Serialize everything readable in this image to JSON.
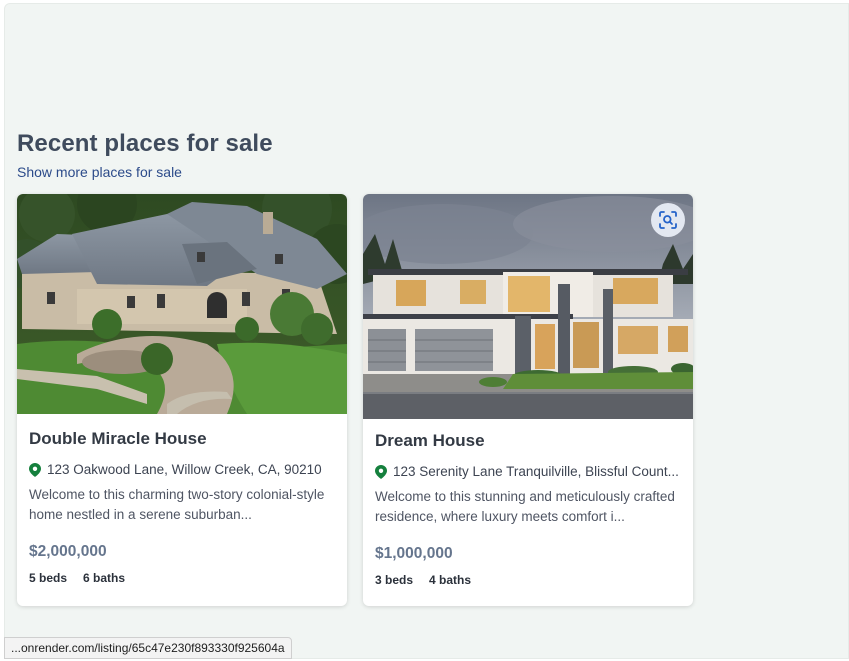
{
  "section": {
    "title": "Recent places for sale",
    "show_more": "Show more places for sale"
  },
  "listings": [
    {
      "title": "Double Miracle House",
      "address": "123 Oakwood Lane, Willow Creek, CA, 90210",
      "description": "Welcome to this charming two-story colonial-style home nestled in a serene suburban...",
      "price": "$2,000,000",
      "beds": "5 beds",
      "baths": "6 baths"
    },
    {
      "title": "Dream House",
      "address": "123 Serenity Lane Tranquilville, Blissful Count...",
      "description": "Welcome to this stunning and meticulously crafted residence, where luxury meets comfort i...",
      "price": "$1,000,000",
      "beds": "3 beds",
      "baths": "4 baths"
    }
  ],
  "status_bar": {
    "url": "...onrender.com/listing/65c47e230f893330f925604a"
  },
  "colors": {
    "page_background": "#f1f5f3",
    "title": "#3f4b5d",
    "link": "#2c4b8a",
    "price": "#65758d",
    "pin": "#15803d"
  },
  "icons": {
    "pin": "map-pin-icon",
    "visual_search": "visual-search-icon"
  }
}
